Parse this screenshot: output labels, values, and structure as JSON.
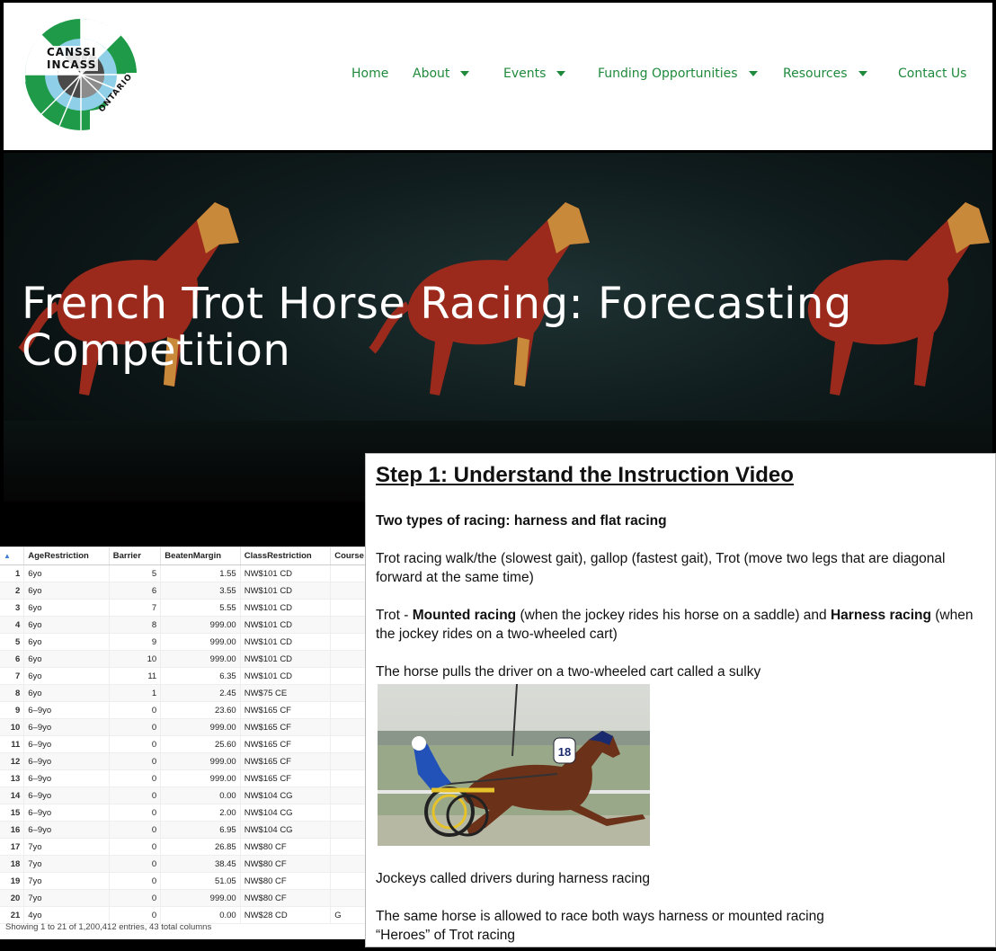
{
  "logo": {
    "line1": "CANSSI",
    "line2": "INCASS",
    "line3": "ONTARIO"
  },
  "nav": {
    "items": [
      {
        "label": "Home",
        "has_dropdown": false
      },
      {
        "label": "About",
        "has_dropdown": true
      },
      {
        "label": "Events",
        "has_dropdown": true
      },
      {
        "label": "Funding Opportunities",
        "has_dropdown": true
      },
      {
        "label": "Resources",
        "has_dropdown": true
      },
      {
        "label": "Contact Us",
        "has_dropdown": false
      }
    ],
    "color": "#1f8a3c"
  },
  "hero": {
    "title": "French Trot Horse Racing: Forecasting Competition"
  },
  "table": {
    "columns": [
      "AgeRestriction",
      "Barrier",
      "BeatenMargin",
      "ClassRestriction",
      "Course"
    ],
    "rows": [
      [
        "1",
        "6yo",
        "5",
        "1.55",
        "NW$101 CD",
        ""
      ],
      [
        "2",
        "6yo",
        "6",
        "3.55",
        "NW$101 CD",
        ""
      ],
      [
        "3",
        "6yo",
        "7",
        "5.55",
        "NW$101 CD",
        ""
      ],
      [
        "4",
        "6yo",
        "8",
        "999.00",
        "NW$101 CD",
        ""
      ],
      [
        "5",
        "6yo",
        "9",
        "999.00",
        "NW$101 CD",
        ""
      ],
      [
        "6",
        "6yo",
        "10",
        "999.00",
        "NW$101 CD",
        ""
      ],
      [
        "7",
        "6yo",
        "11",
        "6.35",
        "NW$101 CD",
        ""
      ],
      [
        "8",
        "6yo",
        "1",
        "2.45",
        "NW$75 CE",
        ""
      ],
      [
        "9",
        "6–9yo",
        "0",
        "23.60",
        "NW$165 CF",
        ""
      ],
      [
        "10",
        "6–9yo",
        "0",
        "999.00",
        "NW$165 CF",
        ""
      ],
      [
        "11",
        "6–9yo",
        "0",
        "25.60",
        "NW$165 CF",
        ""
      ],
      [
        "12",
        "6–9yo",
        "0",
        "999.00",
        "NW$165 CF",
        ""
      ],
      [
        "13",
        "6–9yo",
        "0",
        "999.00",
        "NW$165 CF",
        ""
      ],
      [
        "14",
        "6–9yo",
        "0",
        "0.00",
        "NW$104 CG",
        ""
      ],
      [
        "15",
        "6–9yo",
        "0",
        "2.00",
        "NW$104 CG",
        ""
      ],
      [
        "16",
        "6–9yo",
        "0",
        "6.95",
        "NW$104 CG",
        ""
      ],
      [
        "17",
        "7yo",
        "0",
        "26.85",
        "NW$80 CF",
        ""
      ],
      [
        "18",
        "7yo",
        "0",
        "38.45",
        "NW$80 CF",
        ""
      ],
      [
        "19",
        "7yo",
        "0",
        "51.05",
        "NW$80 CF",
        ""
      ],
      [
        "20",
        "7yo",
        "0",
        "999.00",
        "NW$80 CF",
        ""
      ],
      [
        "21",
        "4yo",
        "0",
        "0.00",
        "NW$28 CD",
        "G"
      ]
    ],
    "footer": "Showing 1 to 21 of 1,200,412 entries, 43 total columns"
  },
  "doc": {
    "heading": "Step 1: Understand the Instruction Video",
    "subheading": "Two types of racing: harness and flat racing",
    "p1": "Trot racing walk/the (slowest gait), gallop (fastest gait), Trot (move two legs that are diagonal forward at the same time)",
    "p2_a": "Trot - ",
    "p2_b": "Mounted racing",
    "p2_c": " (when the jockey rides his horse on a saddle) and ",
    "p2_d": "Harness racing",
    "p2_e": " (when the jockey rides on a two-wheeled cart)",
    "p3": "The horse pulls the driver on a two-wheeled cart called a sulky",
    "photo_bib": "18",
    "p4": "Jockeys called drivers during harness racing",
    "p5": "The same horse is allowed to race both ways harness or mounted racing",
    "p6": "“Heroes” of Trot racing"
  }
}
